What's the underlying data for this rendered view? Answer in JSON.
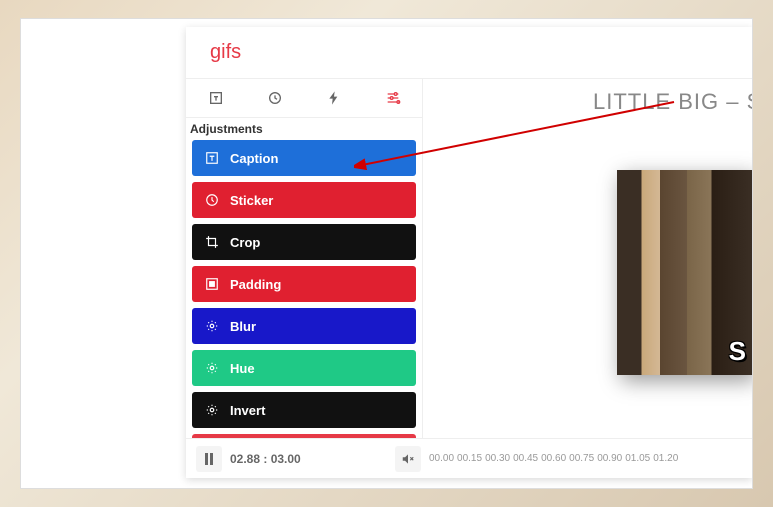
{
  "header": {
    "title": "gifs"
  },
  "tooltabs": {
    "caption_tab": "caption",
    "timer_tab": "timer",
    "effects_tab": "effects",
    "adjustments_tab": "adjustments"
  },
  "sidebar": {
    "section_label": "Adjustments",
    "items": [
      {
        "label": "Caption",
        "color": "#1e6fd9",
        "icon": "caption"
      },
      {
        "label": "Sticker",
        "color": "#e02030",
        "icon": "sticker"
      },
      {
        "label": "Crop",
        "color": "#111111",
        "icon": "crop"
      },
      {
        "label": "Padding",
        "color": "#e02030",
        "icon": "padding"
      },
      {
        "label": "Blur",
        "color": "#1818c9",
        "icon": "blur"
      },
      {
        "label": "Hue",
        "color": "#1fc986",
        "icon": "hue"
      },
      {
        "label": "Invert",
        "color": "#111111",
        "icon": "invert"
      }
    ]
  },
  "preview": {
    "title": "LITTLE BIG – SKIE",
    "overlay_letter": "S"
  },
  "playback": {
    "current": "02.88",
    "total": "03.00",
    "ticks": [
      "00.00",
      "00.15",
      "00.30",
      "00.45",
      "00.60",
      "00.75",
      "00.90",
      "01.05",
      "01.20"
    ]
  }
}
